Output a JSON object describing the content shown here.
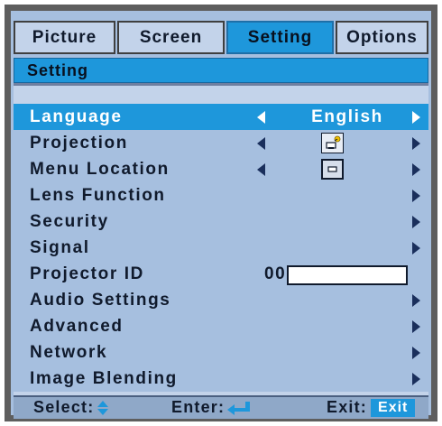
{
  "tabs": [
    {
      "label": "Picture",
      "active": false
    },
    {
      "label": "Screen",
      "active": false
    },
    {
      "label": "Setting",
      "active": true
    },
    {
      "label": "Options",
      "active": false
    }
  ],
  "section_title": "Setting",
  "menu": {
    "language": {
      "label": "Language",
      "value": "English"
    },
    "projection": {
      "label": "Projection",
      "icon": "front-projection-icon"
    },
    "menu_location": {
      "label": "Menu Location",
      "icon": "menu-location-center-icon"
    },
    "lens_function": {
      "label": "Lens Function"
    },
    "security": {
      "label": "Security"
    },
    "signal": {
      "label": "Signal"
    },
    "projector_id": {
      "label": "Projector ID",
      "value": "00"
    },
    "audio_settings": {
      "label": "Audio Settings"
    },
    "advanced": {
      "label": "Advanced"
    },
    "network": {
      "label": "Network"
    },
    "image_blending": {
      "label": "Image Blending"
    }
  },
  "footer": {
    "select_label": "Select:",
    "enter_label": "Enter:",
    "exit_label": "Exit:",
    "exit_badge": "Exit"
  },
  "colors": {
    "accent": "#1e97db",
    "panel": "#a6bfdf",
    "frame": "#5e5e5e",
    "text": "#101a2c"
  }
}
